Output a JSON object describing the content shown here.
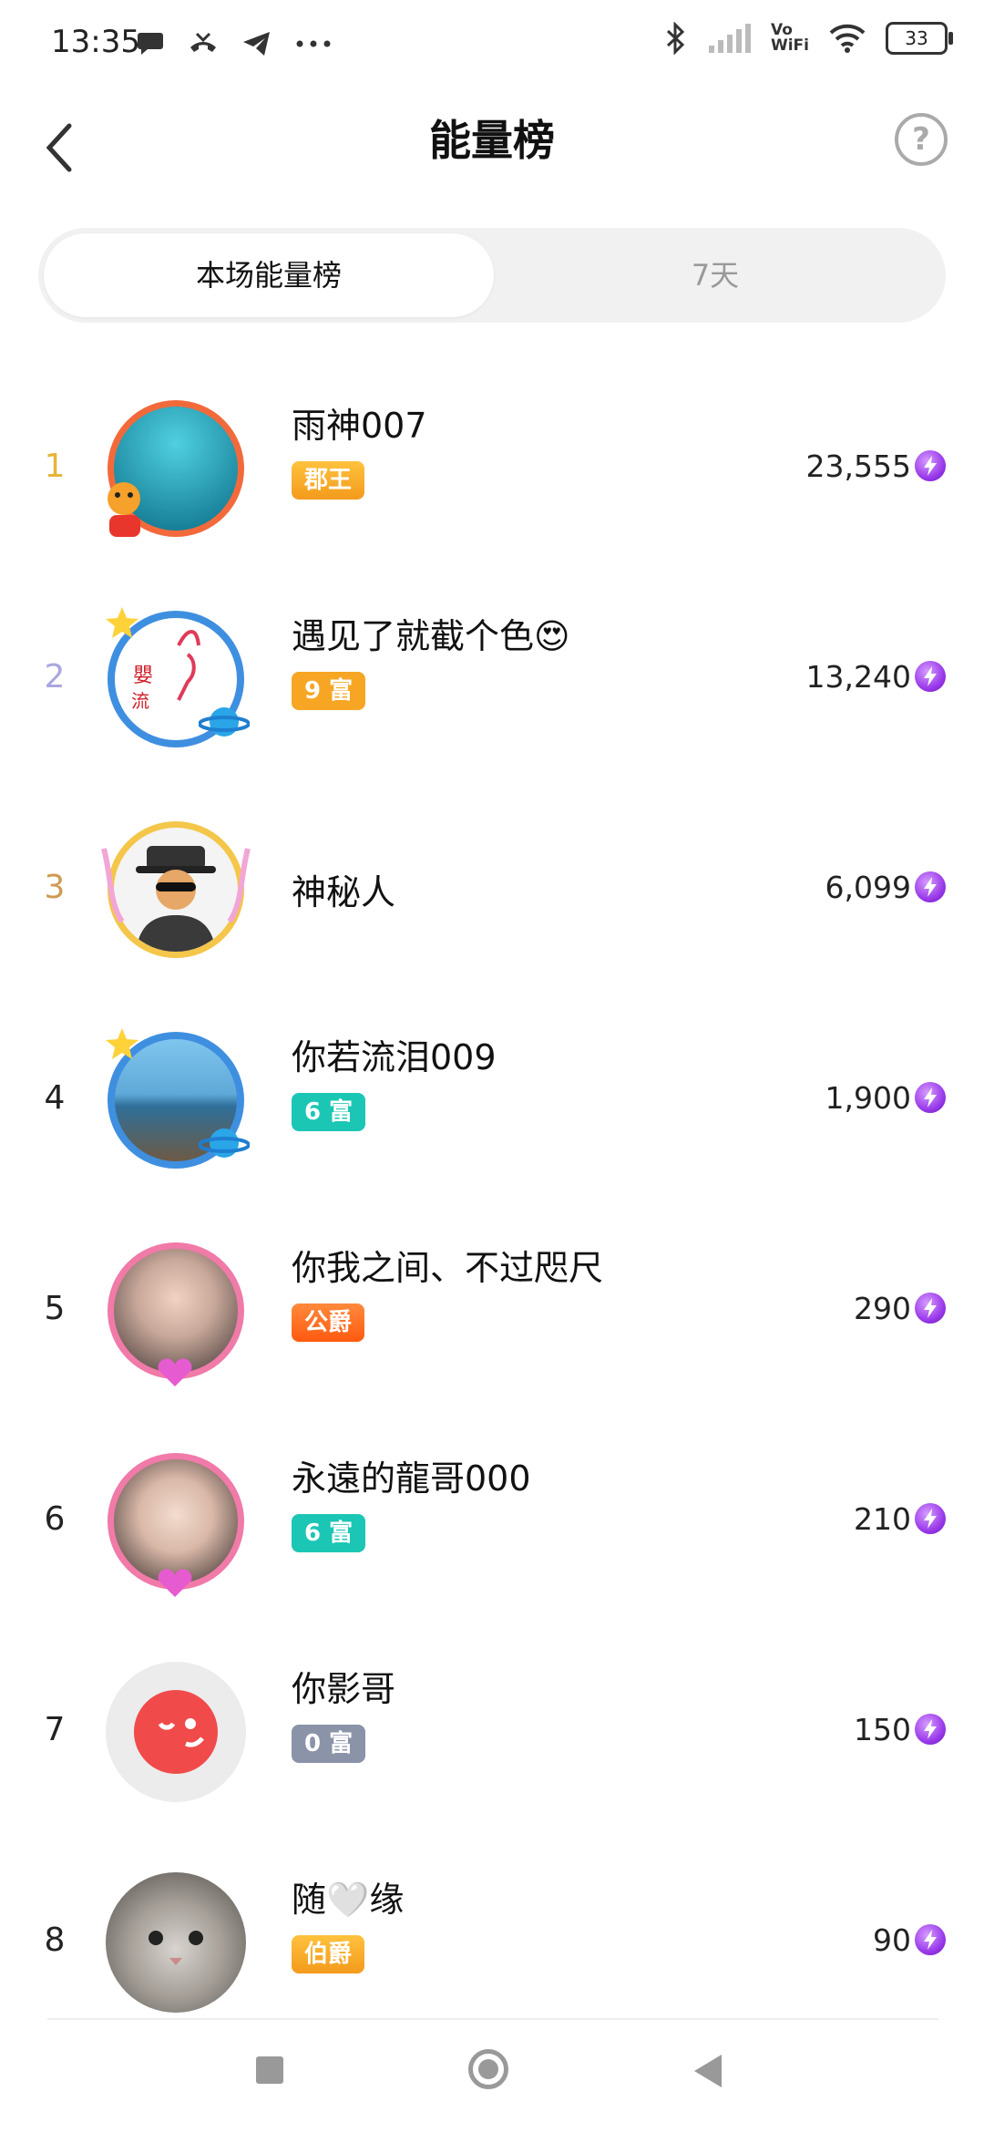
{
  "status_bar": {
    "time": "13:35",
    "left_icons": [
      "chat-bubble-icon",
      "missed-call-icon",
      "telegram-icon",
      "more-dots-icon"
    ],
    "right_icons": [
      "bluetooth-icon",
      "signal-icon",
      "vowifi-icon",
      "wifi-icon",
      "battery-icon"
    ],
    "vowifi_top": "Vo",
    "vowifi_bottom": "WiFi",
    "battery": "33"
  },
  "header": {
    "title": "能量榜",
    "back_icon": "chevron-left-icon",
    "help_icon": "question-circle-icon",
    "help_glyph": "?"
  },
  "tabs": [
    {
      "label": "本场能量榜",
      "active": true
    },
    {
      "label": "7天",
      "active": false
    }
  ],
  "ranking": [
    {
      "rank": "1",
      "name": "雨神007",
      "badge": "郡王",
      "score": "23,555"
    },
    {
      "rank": "2",
      "name": "遇见了就截个色😍",
      "badge": "9 富",
      "score": "13,240"
    },
    {
      "rank": "3",
      "name": "神秘人",
      "badge": "",
      "score": "6,099"
    },
    {
      "rank": "4",
      "name": "你若流泪009",
      "badge": "6 富",
      "score": "1,900"
    },
    {
      "rank": "5",
      "name": "你我之间、不过咫尺",
      "badge": "公爵",
      "score": "290"
    },
    {
      "rank": "6",
      "name": "永遠的龍哥000",
      "badge": "6 富",
      "score": "210"
    },
    {
      "rank": "7",
      "name": "你影哥",
      "badge": "0 富",
      "score": "150"
    },
    {
      "rank": "8",
      "name": "随🤍缘",
      "badge": "伯爵",
      "score": "90"
    }
  ],
  "colors": {
    "rank_1": "#e6b43a",
    "rank_2": "#a9a6e0",
    "rank_3": "#cf9a52",
    "rank_default": "#222222",
    "badge_gold": "#f6a623",
    "badge_teal": "#1cc6b4",
    "badge_gray": "#8a93a8",
    "badge_orange": "#ff6a1f",
    "energy_purple": "#9a3bea"
  },
  "nav_bar": {
    "items": [
      "recent-apps-icon",
      "home-icon",
      "back-icon"
    ]
  }
}
